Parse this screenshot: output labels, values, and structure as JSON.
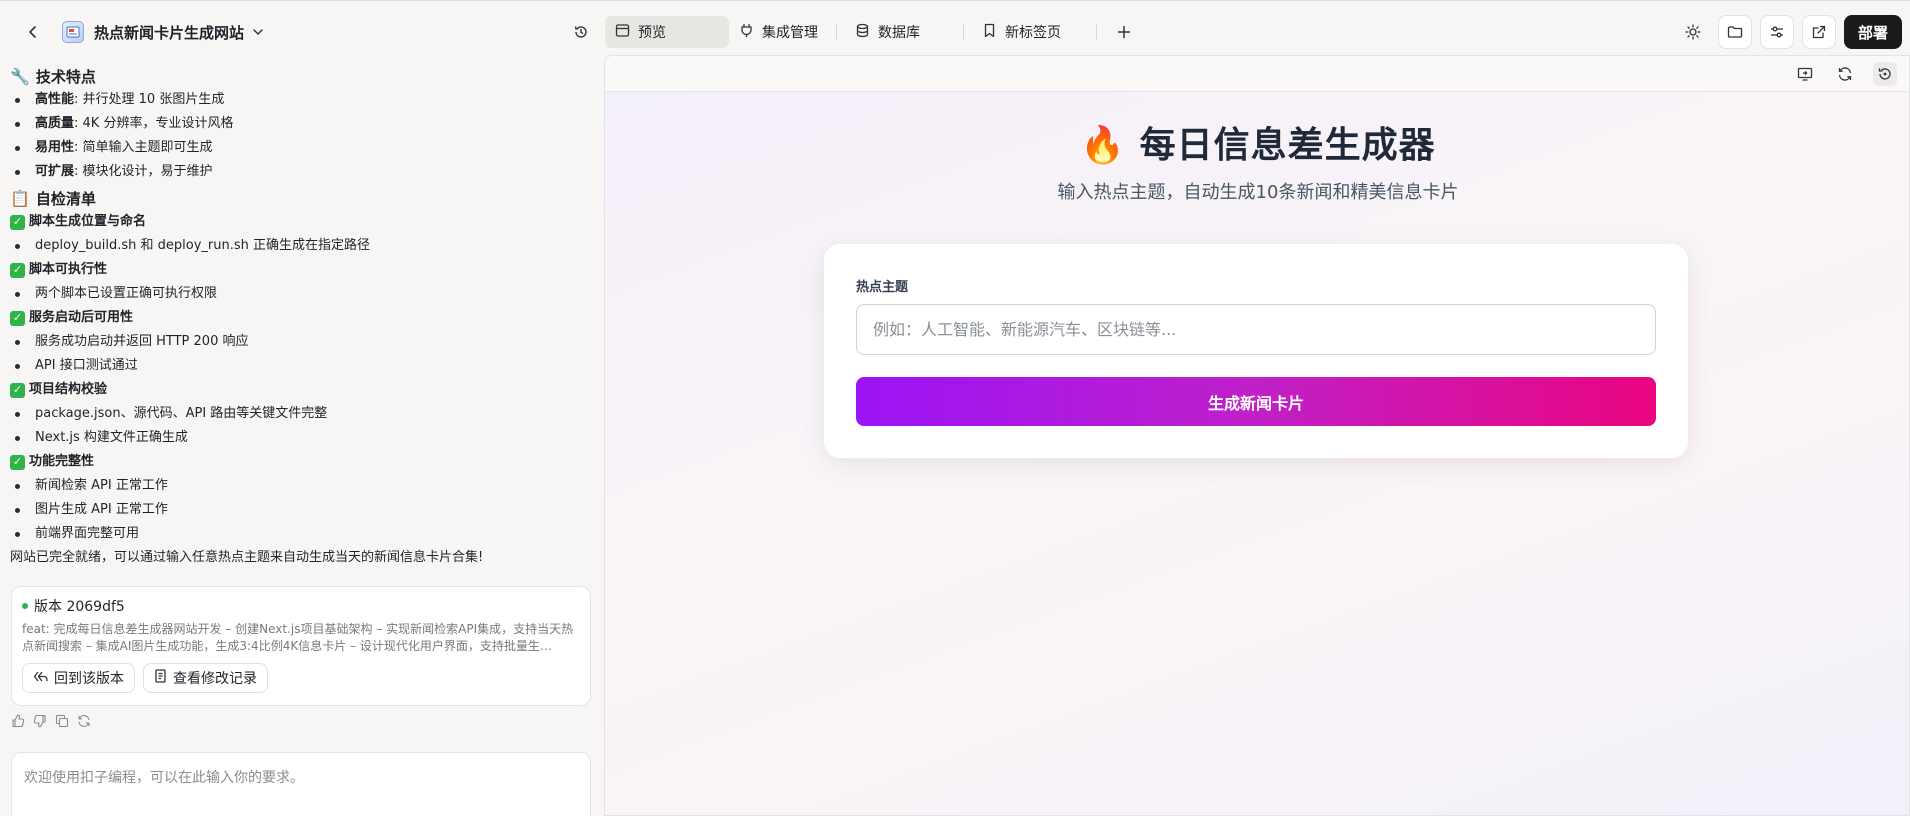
{
  "topbar": {
    "project_title": "热点新闻卡片生成网站",
    "tabs": [
      {
        "label": "预览",
        "icon": "browser-window-icon"
      },
      {
        "label": "集成管理",
        "icon": "plug-icon"
      },
      {
        "label": "数据库",
        "icon": "database-icon"
      },
      {
        "label": "新标签页",
        "icon": "bookmark-icon"
      }
    ],
    "deploy_label": "部署"
  },
  "chat": {
    "tech_title_icon": "🔧",
    "tech_title": "技术特点",
    "tech_items": [
      {
        "bold": "高性能",
        "text": ": 并行处理 10 张图片生成"
      },
      {
        "bold": "高质量",
        "text": ": 4K 分辨率，专业设计风格"
      },
      {
        "bold": "易用性",
        "text": ": 简单输入主题即可生成"
      },
      {
        "bold": "可扩展",
        "text": ": 模块化设计，易于维护"
      }
    ],
    "checklist_title_icon": "📋",
    "checklist_title": "自检清单",
    "checks": [
      {
        "title": "脚本生成位置与命名",
        "items": [
          "deploy_build.sh 和 deploy_run.sh 正确生成在指定路径"
        ]
      },
      {
        "title": "脚本可执行性",
        "items": [
          "两个脚本已设置正确可执行权限"
        ]
      },
      {
        "title": "服务启动后可用性",
        "items": [
          "服务成功启动并返回 HTTP 200 响应",
          "API 接口测试通过"
        ]
      },
      {
        "title": "项目结构校验",
        "items": [
          "package.json、源代码、API 路由等关键文件完整",
          "Next.js 构建文件正确生成"
        ]
      },
      {
        "title": "功能完整性",
        "items": [
          "新闻检索 API 正常工作",
          "图片生成 API 正常工作",
          "前端界面完整可用"
        ]
      }
    ],
    "final_line": "网站已完全就绪，可以通过输入任意热点主题来自动生成当天的新闻信息卡片合集!",
    "version": {
      "label": "版本 2069df5",
      "desc": "feat: 完成每日信息差生成器网站开发 – 创建Next.js项目基础架构 – 实现新闻检索API集成，支持当天热点新闻搜索 – 集成AI图片生成功能，生成3:4比例4K信息卡片 – 设计现代化用户界面，支持批量生…",
      "revert_label": "回到该版本",
      "changes_label": "查看修改记录"
    },
    "input_placeholder": "欢迎使用扣子编程，可以在此输入你的要求。"
  },
  "preview": {
    "title_emoji": "🔥",
    "title": "每日信息差生成器",
    "subtitle": "输入热点主题，自动生成10条新闻和精美信息卡片",
    "field_label": "热点主题",
    "field_placeholder": "例如：人工智能、新能源汽车、区块链等...",
    "button_label": "生成新闻卡片"
  },
  "colors": {
    "deploy_bg": "#1a1a1a",
    "check_green": "#2fb34a",
    "gradient_start": "#9b14f5",
    "gradient_end": "#e9057f"
  }
}
